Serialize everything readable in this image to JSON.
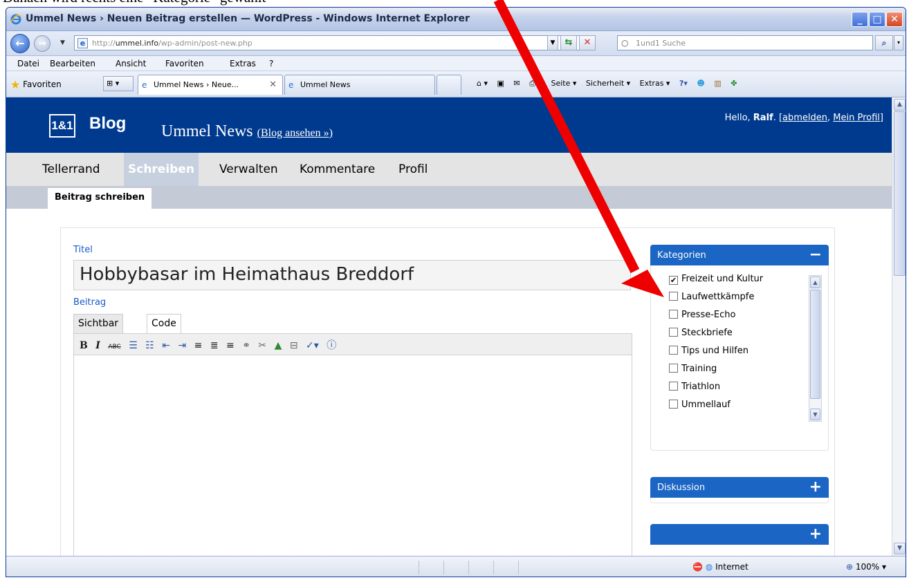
{
  "caption": "Danach wird rechts eine \"Kategorie\" gewählt",
  "window": {
    "title": "Ummel News › Neuen Beitrag erstellen — WordPress - Windows Internet Explorer",
    "buttons": [
      "_",
      "□",
      "✕"
    ]
  },
  "addressbar": {
    "url_prefix": "http://",
    "url_host": "ummel.info",
    "url_path": "/wp-admin/post-new.php",
    "search_placeholder": "1und1 Suche"
  },
  "menu": [
    "Datei",
    "Bearbeiten",
    "Ansicht",
    "Favoriten",
    "Extras",
    "?"
  ],
  "favorites": {
    "label": "Favoriten",
    "tabs": [
      {
        "label": "Ummel News › Neue...",
        "active": true
      },
      {
        "label": "Ummel News",
        "active": false
      }
    ],
    "commands": [
      "Seite ▾",
      "Sicherheit ▾",
      "Extras ▾"
    ]
  },
  "wp": {
    "brand": "1&1",
    "brand_word": "Blog",
    "blog_name": "Ummel News",
    "blog_link": "(Blog ansehen »)",
    "hello_prefix": "Hello, ",
    "user": "Ralf",
    "logout": "abmelden",
    "profile_link": "Mein Profil",
    "nav": [
      "Tellerrand",
      "Schreiben",
      "Verwalten",
      "Kommentare",
      "Profil"
    ],
    "nav_selected": "Schreiben",
    "subnav": "Beitrag schreiben",
    "title_label": "Titel",
    "title_value": "Hobbybasar im Heimathaus Breddorf",
    "content_label": "Beitrag",
    "editor_tabs": [
      "Sichtbar",
      "Code"
    ],
    "categories_title": "Kategorien",
    "categories": [
      {
        "name": "Freizeit und Kultur",
        "checked": true
      },
      {
        "name": "Laufwettkämpfe",
        "checked": false
      },
      {
        "name": "Presse-Echo",
        "checked": false
      },
      {
        "name": "Steckbriefe",
        "checked": false
      },
      {
        "name": "Tips und Hilfen",
        "checked": false
      },
      {
        "name": "Training",
        "checked": false
      },
      {
        "name": "Triathlon",
        "checked": false
      },
      {
        "name": "Ummellauf",
        "checked": false
      }
    ],
    "discussion_title": "Diskussion"
  },
  "status": {
    "zone": "Internet",
    "zoom": "100%"
  },
  "colors": {
    "wp_header": "#003a8e",
    "box_header": "#1b65c4",
    "arrow": "#ee0000"
  }
}
